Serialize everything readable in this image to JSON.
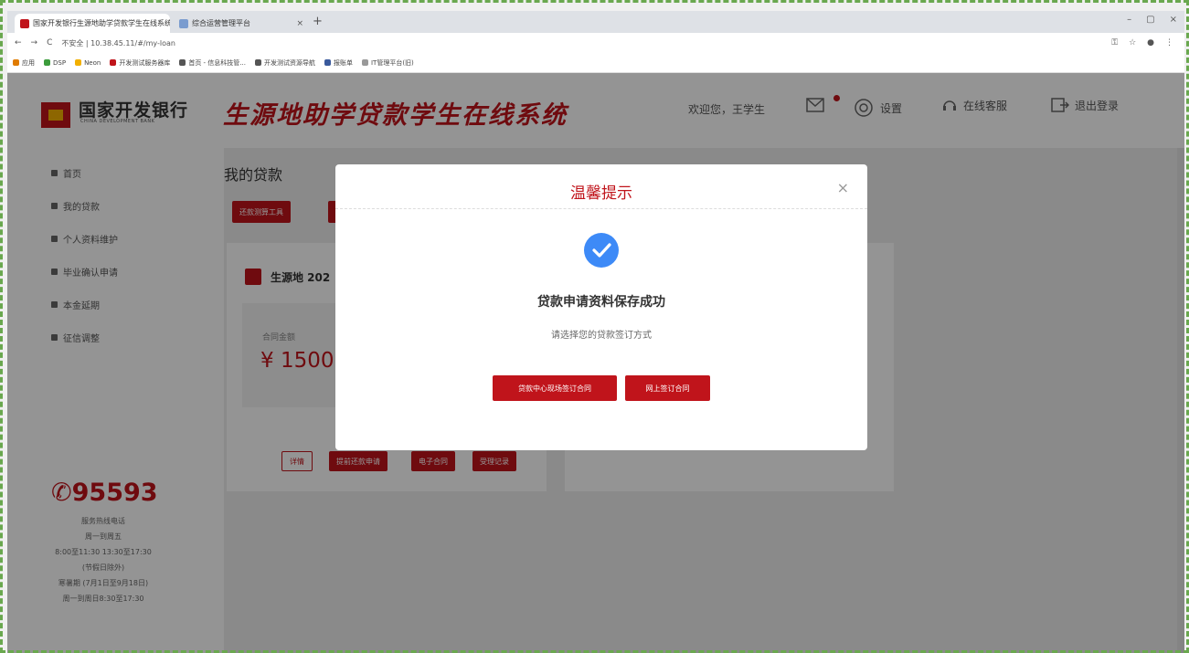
{
  "browser": {
    "tabs": [
      {
        "title": "国家开发银行生源地助学贷款学生在线系统",
        "active": true
      },
      {
        "title": "综合运营管理平台",
        "active": false
      }
    ],
    "address": "不安全 | 10.38.45.11/#/my-loan",
    "bookmarks": [
      "应用",
      "DSP",
      "Neon",
      "开发测试服务器库",
      "首页 - 信息科技管...",
      "开发测试资源导航",
      "报账单",
      "IT管理平台(旧)"
    ]
  },
  "header": {
    "logo_cn": "国家开发银行",
    "logo_en": "CHINA DEVELOPMENT BANK",
    "system_title": "生源地助学贷款学生在线系统",
    "welcome": "欢迎您，王学生",
    "settings_label": "设置",
    "service_label": "在线客服",
    "logout_label": "退出登录"
  },
  "sidebar": {
    "items": [
      "首页",
      "我的贷款",
      "个人资料维护",
      "毕业确认申请",
      "本金延期",
      "征信调整"
    ],
    "hotline": "95593",
    "hotline_info": [
      "服务热线电话",
      "周一到周五",
      "8:00至11:30 13:30至17:30",
      "(节假日除外)",
      "寒暑期 (7月1日至9月18日)",
      "周一到周日8:30至17:30"
    ]
  },
  "content": {
    "title": "我的贷款",
    "tools": [
      "还款测算工具"
    ],
    "card_title": "生源地 202",
    "amount_label": "合同金额",
    "amount_value": "¥ 1500",
    "card_buttons": [
      "详情",
      "提前还款申请",
      "电子合同",
      "受理记录"
    ]
  },
  "modal": {
    "title": "温馨提示",
    "close": "×",
    "message": "贷款申请资料保存成功",
    "sub_message": "请选择您的贷款签订方式",
    "btn_offline": "贷款中心现场签订合同",
    "btn_online": "网上签订合同"
  },
  "colors": {
    "brand": "#c0141b",
    "check": "#3d8af7"
  }
}
